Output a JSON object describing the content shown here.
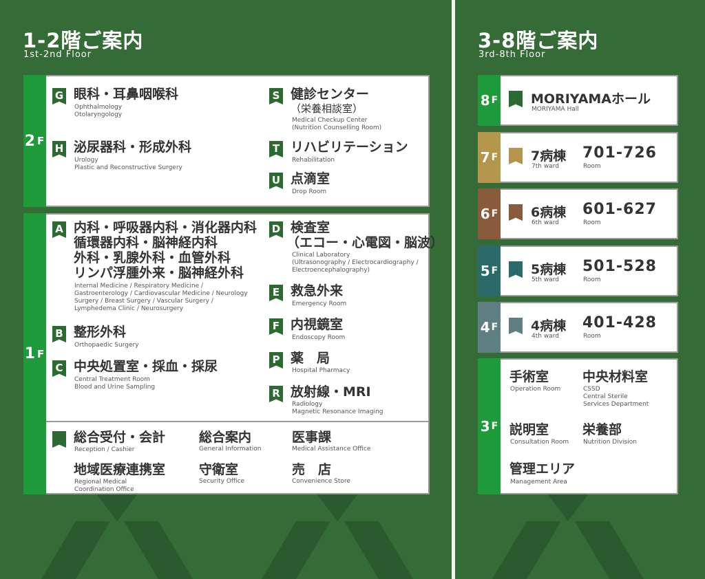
{
  "left": {
    "title": "1-2階ご案内",
    "subtitle": "1st-2nd Floor",
    "floor2": {
      "label": "2",
      "suffix": "F",
      "items": [
        {
          "badge": "G",
          "jp": "眼科・耳鼻咽喉科",
          "en1": "Ophthalmology",
          "en2": "Otolaryngology"
        },
        {
          "badge": "H",
          "jp": "泌尿器科・形成外科",
          "en1": "Urology",
          "en2": "Plastic and Reconstructive Surgery"
        },
        {
          "badge": "S",
          "jp": "健診センター",
          "jp2": "（栄養相談室）",
          "en1": "Medical Checkup Center",
          "en2": "(Nutrition Counselling Room)"
        },
        {
          "badge": "T",
          "jp": "リハビリテーション",
          "en1": "Rehabilitation"
        },
        {
          "badge": "U",
          "jp": "点滴室",
          "en1": "Drop Room"
        }
      ]
    },
    "floor1": {
      "label": "1",
      "suffix": "F",
      "items": [
        {
          "badge": "A",
          "jp": "内科・呼吸器内科・消化器内科",
          "jp2": "循環器内科・脳神経内科",
          "jp3": "外科・乳腺外科・血管外科",
          "jp4": "リンパ浮腫外来・脳神経外科",
          "en1": "Internal Medicine / Respiratory Medicine /",
          "en2": "Gastroenterology / Cardiovascular Medicine / Neurology",
          "en3": "Surgery / Breast Surgery / Vascular Surgery /",
          "en4": "Lymphedema Clinic / Neurosurgery"
        },
        {
          "badge": "B",
          "jp": "整形外科",
          "en1": "Orthopaedic Surgery"
        },
        {
          "badge": "C",
          "jp": "中央処置室・採血・採尿",
          "en1": "Central Treatment Room",
          "en2": "Blood and Urine Sampling"
        },
        {
          "badge": "D",
          "jp": "検査室",
          "jp2": "（エコー・心電図・脳波）",
          "en1": "Clinical Laboratory",
          "en2": "(Ultrasonography / Electrocardiography /",
          "en3": "Electroencephalography)"
        },
        {
          "badge": "E",
          "jp": "救急外来",
          "en1": "Emergency Room"
        },
        {
          "badge": "F",
          "jp": "内視鏡室",
          "en1": "Endoscopy Room"
        },
        {
          "badge": "P",
          "jp": "薬　局",
          "en1": "Hospital Pharmacy"
        },
        {
          "badge": "R",
          "jp": "放射線・MRI",
          "en1": "Radiology",
          "en2": "Magnetic Resonance Imaging"
        }
      ],
      "services": [
        {
          "jp": "総合受付・会計",
          "en1": "Reception / Cashier"
        },
        {
          "jp": "総合案内",
          "en1": "General Information"
        },
        {
          "jp": "医事課",
          "en1": "Medical Assistance Office"
        },
        {
          "jp": "地域医療連携室",
          "en1": "Regional Medical",
          "en2": "Coordination Office"
        },
        {
          "jp": "守衛室",
          "en1": "Security Office"
        },
        {
          "jp": "売　店",
          "en1": "Convenience Store"
        }
      ]
    }
  },
  "right": {
    "title": "3-8階ご案内",
    "subtitle": "3rd-8th Floor",
    "floors": [
      {
        "num": "8",
        "suffix": "F",
        "color": "#1f9a3a",
        "flag": "#2d6a31",
        "jp": "MORIYAMAホール",
        "en": "MORIYAMA Hall"
      },
      {
        "num": "7",
        "suffix": "F",
        "color": "#b3954b",
        "flag": "#b3954b",
        "jp": "7病棟",
        "en": "7th ward",
        "room": "701-726",
        "room_label": "Room"
      },
      {
        "num": "6",
        "suffix": "F",
        "color": "#8a5a3c",
        "flag": "#8a5a3c",
        "jp": "6病棟",
        "en": "6th ward",
        "room": "601-627",
        "room_label": "Room"
      },
      {
        "num": "5",
        "suffix": "F",
        "color": "#2a6b6a",
        "flag": "#2a6b6a",
        "jp": "5病棟",
        "en": "5th ward",
        "room": "501-528",
        "room_label": "Room"
      },
      {
        "num": "4",
        "suffix": "F",
        "color": "#5f7f82",
        "flag": "#5f7f82",
        "jp": "4病棟",
        "en": "4th ward",
        "room": "401-428",
        "room_label": "Room"
      }
    ],
    "floor3": {
      "num": "3",
      "suffix": "F",
      "items": [
        {
          "jp": "手術室",
          "en1": "Operation Room"
        },
        {
          "jp": "中央材料室",
          "en1": "CSSD",
          "en2": "Central Sterile",
          "en3": "Services Department"
        },
        {
          "jp": "説明室",
          "en1": "Consultation Room"
        },
        {
          "jp": "栄養部",
          "en1": "Nutrition Division"
        },
        {
          "jp": "管理エリア",
          "en1": "Management Area"
        }
      ]
    }
  }
}
